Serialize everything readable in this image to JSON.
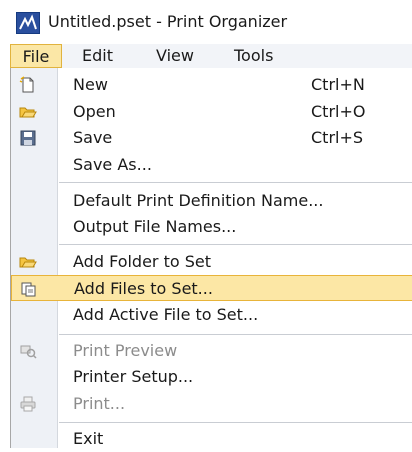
{
  "window": {
    "title": "Untitled.pset - Print Organizer",
    "app_icon": "print-organizer-icon"
  },
  "menubar": {
    "items": [
      {
        "label": "File",
        "active": true
      },
      {
        "label": "Edit"
      },
      {
        "label": "View"
      },
      {
        "label": "Tools"
      }
    ]
  },
  "file_menu": {
    "items": [
      {
        "label": "New",
        "shortcut": "Ctrl+N",
        "icon": "new-document-icon"
      },
      {
        "label": "Open",
        "shortcut": "Ctrl+O",
        "icon": "open-folder-icon"
      },
      {
        "label": "Save",
        "shortcut": "Ctrl+S",
        "icon": "save-disk-icon"
      },
      {
        "label": "Save As..."
      },
      {
        "label": "Default Print Definition Name..."
      },
      {
        "label": "Output File Names..."
      },
      {
        "label": "Add Folder to Set",
        "icon": "add-folder-icon"
      },
      {
        "label": "Add Files to Set...",
        "icon": "add-files-icon",
        "highlighted": true
      },
      {
        "label": "Add Active File to Set..."
      },
      {
        "label": "Print Preview",
        "icon": "print-preview-icon",
        "disabled": true
      },
      {
        "label": "Printer Setup..."
      },
      {
        "label": "Print...",
        "icon": "printer-icon",
        "disabled": true
      },
      {
        "label": "Exit"
      }
    ]
  },
  "colors": {
    "highlight_fill": "#fce7a5",
    "highlight_border": "#e8b43a",
    "gutter": "#eef1f6",
    "disabled_text": "#8c8c8c"
  }
}
